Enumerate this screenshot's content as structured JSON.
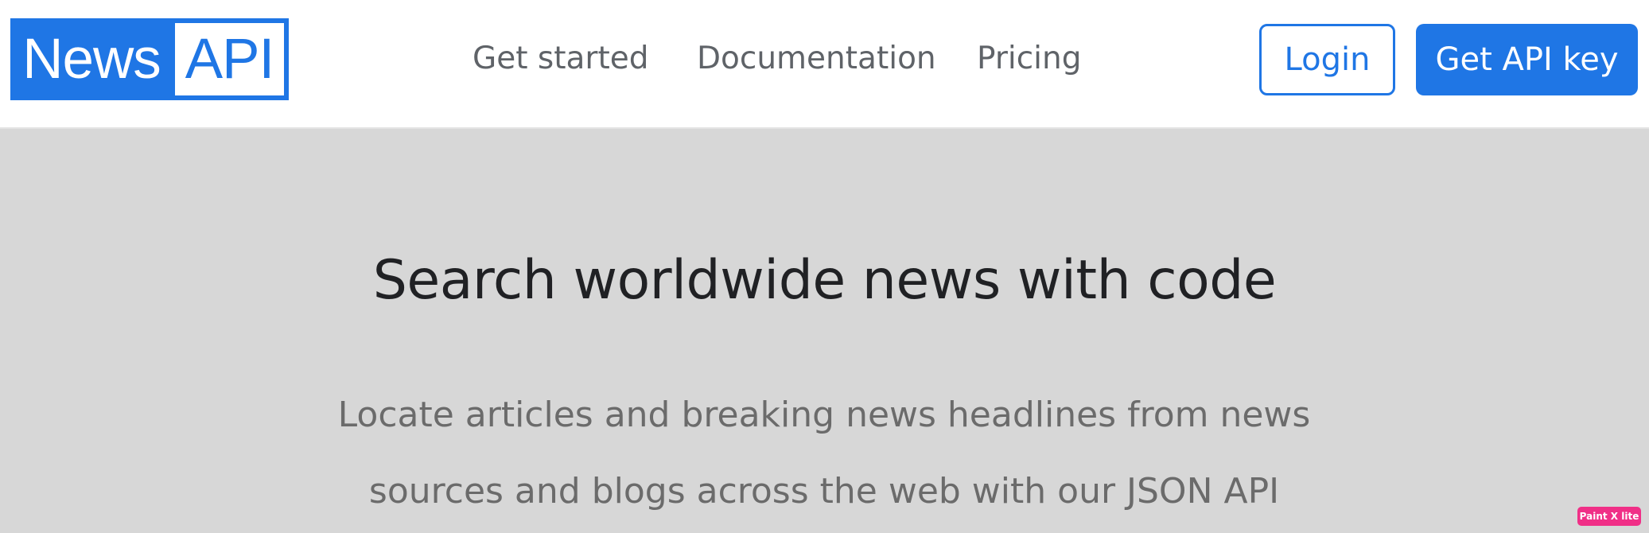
{
  "brand": {
    "part1": "News",
    "part2": "API"
  },
  "nav": [
    {
      "label": "Get started"
    },
    {
      "label": "Documentation"
    },
    {
      "label": "Pricing"
    }
  ],
  "auth": {
    "login_label": "Login",
    "get_key_label": "Get API key"
  },
  "hero": {
    "title": "Search worldwide news with code",
    "subtitle": "Locate articles and breaking news headlines from news sources and blogs across the web with our JSON API"
  },
  "overlay_badge": "Paint X lite",
  "colors": {
    "accent": "#1f76e5",
    "hero_bg": "#d7d7d7",
    "nav_text": "#5f6368"
  }
}
